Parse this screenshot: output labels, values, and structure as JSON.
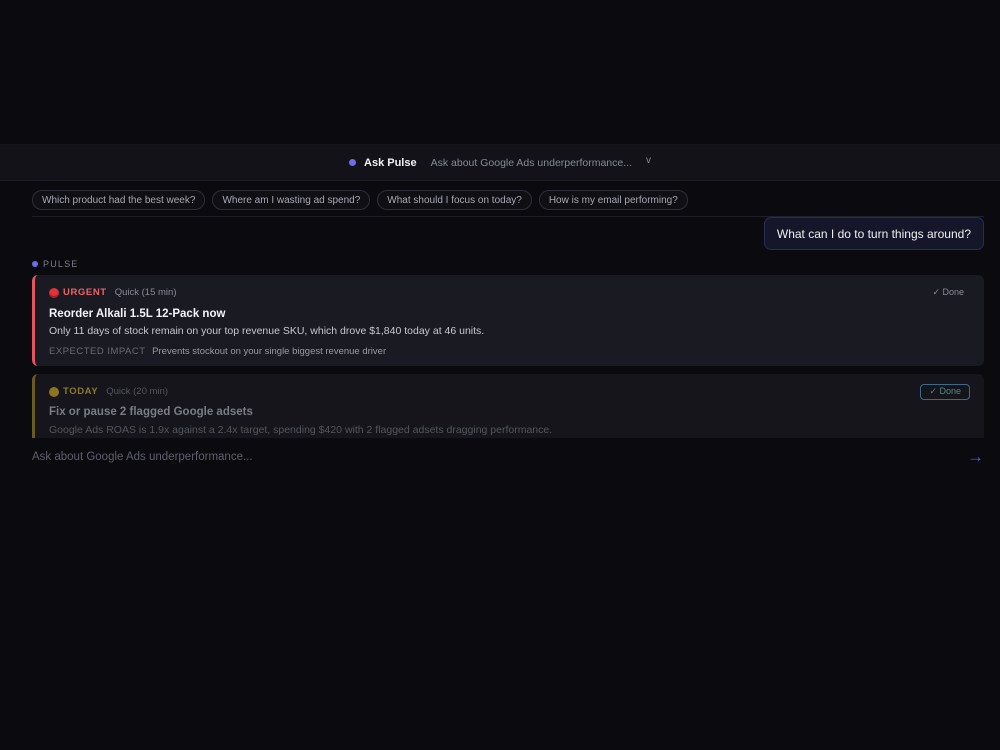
{
  "header": {
    "title": "Ask Pulse",
    "hint": "Ask about Google Ads underperformance...",
    "chevron": "v"
  },
  "suggestions": [
    "Which product had the best week?",
    "Where am I wasting ad spend?",
    "What should I focus on today?",
    "How is my email performing?"
  ],
  "user_message": "What can I do to turn things around?",
  "pulse_label": "PULSE",
  "cards": [
    {
      "priority": "URGENT",
      "meta": "Quick (15 min)",
      "done": "✓ Done",
      "title": "Reorder Alkali 1.5L 12-Pack now",
      "desc": "Only 11 days of stock remain on your top revenue SKU, which drove $1,840 today at 46 units.",
      "impact_label": "EXPECTED IMPACT",
      "impact_value": "Prevents stockout on your single biggest revenue driver",
      "color": "#e0575f"
    },
    {
      "priority": "TODAY",
      "meta": "Quick (20 min)",
      "done": "✓ Done",
      "title": "Fix or pause 2 flagged Google adsets",
      "desc": "Google Ads ROAS is 1.9x against a 2.4x target, spending $420 with 2 flagged adsets dragging performance.",
      "color": "#8c7420"
    }
  ],
  "input": {
    "placeholder": "Ask about Google Ads underperformance...",
    "send_icon": "arrow-right-icon"
  },
  "colors": {
    "accent": "#6b6cf0",
    "background": "#0b0b0f"
  }
}
